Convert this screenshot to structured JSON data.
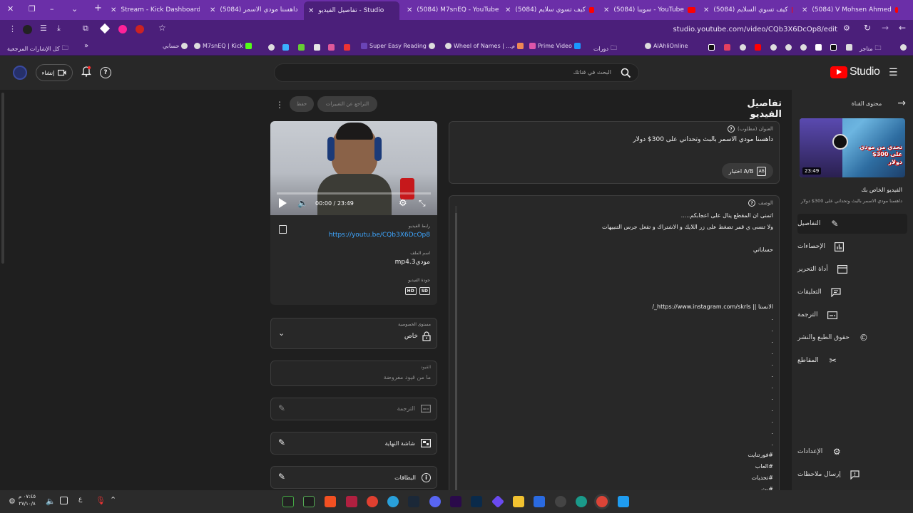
{
  "browser": {
    "tabs": [
      {
        "title": "Stream - Kick Dashboard"
      },
      {
        "title": "(5084) داهسنا مودي الاسمر"
      },
      {
        "title": "تفاصيل الفيديو - Studio"
      },
      {
        "title": "(5084) M7snEQ - YouTube"
      },
      {
        "title": "(5084) كيف تسوي سلايم"
      },
      {
        "title": "(5084) سويبا - YouTube"
      },
      {
        "title": "(5084) كيف تسوي السلايم"
      },
      {
        "title": "(5084) V Mohsen Ahmed"
      }
    ],
    "url": "studio.youtube.com/video/CQb3X6DcOp8/edit",
    "bookmarks": [
      {
        "label": "كل الإشارات المرجعية"
      },
      {
        "label": "حسابي"
      },
      {
        "label": "M7snEQ | Kick"
      },
      {
        "label": "Super Easy Reading"
      },
      {
        "label": "Wheel of Names | ...م"
      },
      {
        "label": "Prime Video"
      },
      {
        "label": "دورات"
      },
      {
        "label": "AlAhliOnline"
      },
      {
        "label": "متاجر"
      }
    ]
  },
  "header": {
    "logo_text": "Studio",
    "search_placeholder": "البحث في قناتك",
    "create_label": "إنشاء"
  },
  "sidebar": {
    "back_label": "محتوى القناة",
    "video_section_title": "الفيديو الخاص بك",
    "video_title": "داهسنا مودي الاسمر بالبث وتحداني على 300$ دولار",
    "thumbnail_duration": "23:49",
    "thumbnail_text": "تحدي من مودي على 300$ دولار",
    "items": [
      {
        "label": "التفاصيل",
        "icon": "pencil-icon"
      },
      {
        "label": "الإحصاءات",
        "icon": "chart-icon"
      },
      {
        "label": "أداة التحرير",
        "icon": "editor-icon"
      },
      {
        "label": "التعليقات",
        "icon": "comment-icon"
      },
      {
        "label": "الترجمة",
        "icon": "subtitles-icon"
      },
      {
        "label": "حقوق الطبع والنشر",
        "icon": "copyright-icon"
      },
      {
        "label": "المقاطع",
        "icon": "scissors-icon"
      }
    ],
    "settings_label": "الإعدادات",
    "feedback_label": "إرسال ملاحظات"
  },
  "main": {
    "page_title": "تفاصيل الفيديو",
    "undo_label": "التراجع عن التغييرات",
    "save_label": "حفظ",
    "title_field": {
      "label": "العنوان (مطلوب)",
      "value": "داهسنا مودي الاسمر بالبث وتحداني على 300$ دولار",
      "ab_label": "اختبار A/B"
    },
    "description": {
      "label": "الوصف",
      "lines": [
        "اتمنى ان المقطع ينال على اعجابكم.....",
        "ولا تنسى ي قمر تضغط على زر اللايك و الاشتراك و تفعل جرس التنبيهات",
        "",
        "حساباتي",
        "",
        "",
        "",
        "",
        "الانستا || https://www.instagram.com/skrls_/"
      ],
      "dots": [
        ".",
        ".",
        ".",
        ".",
        ".",
        ".",
        ".",
        ".",
        ".",
        ".",
        ".",
        "."
      ],
      "hashtags": [
        "#فورتنايت",
        "#العاب",
        "#تحديات",
        "#بث"
      ]
    },
    "video": {
      "time": "00:00 / 23:49",
      "link_label": "رابط الفيديو",
      "link": "https://youtu.be/CQb3X6DcOp8",
      "filename_label": "اسم الملف",
      "filename": "مودي3.mp4",
      "quality_label": "جودة الفيديو",
      "quality_badges": [
        "SD",
        "HD"
      ]
    },
    "visibility": {
      "label": "مستوى الخصوصية",
      "value": "خاص"
    },
    "restrictions": {
      "label": "القيود",
      "value": "ما من قيود مفروضة"
    },
    "subtitles": {
      "label": "الترجمة"
    },
    "end_screen": {
      "label": "شاشة النهاية"
    },
    "cards": {
      "label": "البطاقات"
    }
  },
  "taskbar": {
    "time": "٠٧:٤٥ م",
    "date": "٢٧/١٠/٨"
  }
}
